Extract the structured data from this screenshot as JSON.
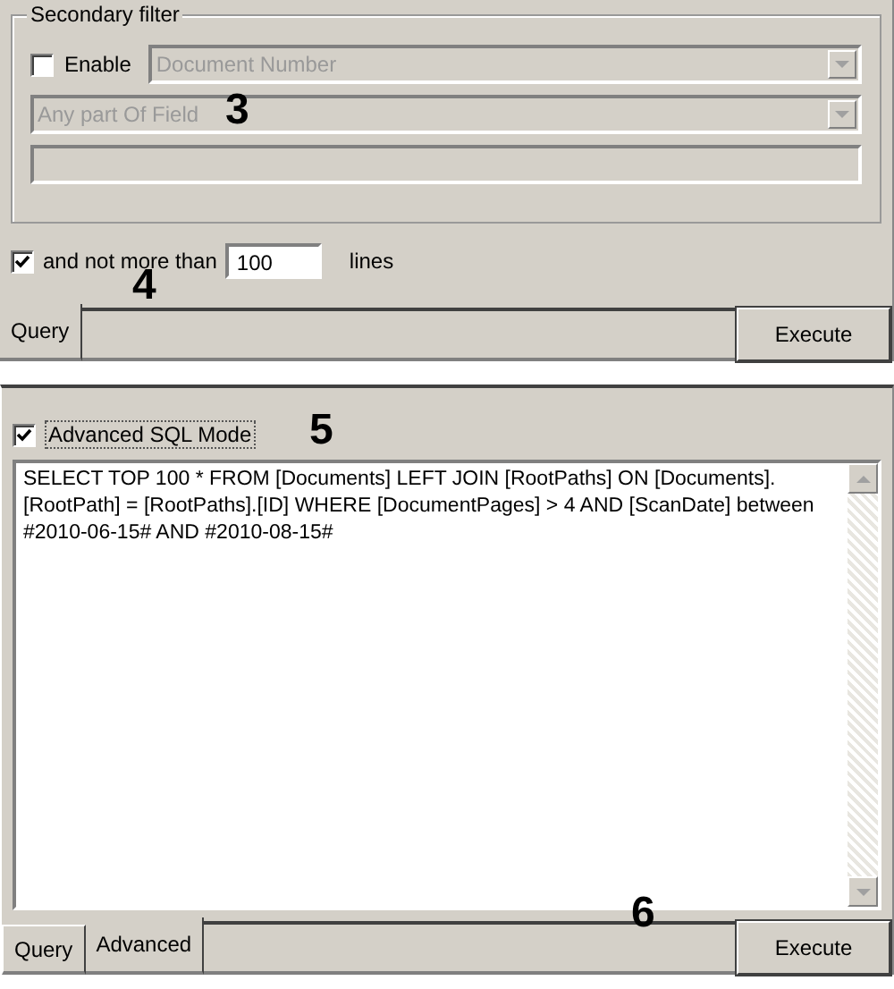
{
  "query_view": {
    "secondary_filter": {
      "title": "Secondary filter",
      "enable": {
        "label": "Enable",
        "checked": false
      },
      "field_dropdown": {
        "value": "Document Number",
        "disabled": true
      },
      "match_dropdown": {
        "value": "Any part Of Field",
        "disabled": true
      },
      "value_field": {
        "disabled": true
      }
    },
    "limit": {
      "checked": true,
      "label": "and not more than",
      "value": "100",
      "suffix": "lines"
    },
    "tabs": [
      {
        "label": "Query",
        "selected": true
      }
    ],
    "execute_button": "Execute",
    "annotations": [
      "3",
      "4"
    ]
  },
  "advanced_view": {
    "sql_mode": {
      "label": "Advanced SQL Mode",
      "checked": true
    },
    "sql_text": "SELECT TOP 100  *  FROM [Documents] LEFT JOIN [RootPaths] ON [Documents].[RootPath] = [RootPaths].[ID] WHERE [DocumentPages] > 4 AND  [ScanDate] between #2010-06-15# AND #2010-08-15#",
    "tabs": [
      {
        "label": "Query",
        "selected": false
      },
      {
        "label": "Advanced",
        "selected": true
      }
    ],
    "execute_button": "Execute",
    "annotations": [
      "5",
      "6"
    ]
  }
}
